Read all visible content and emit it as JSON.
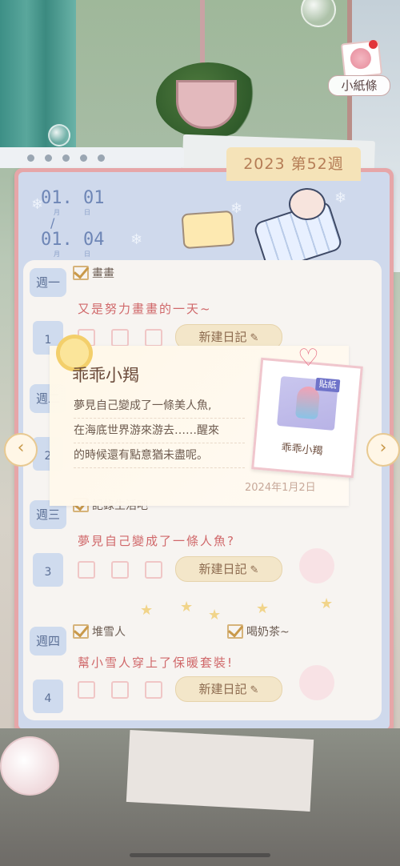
{
  "app": {
    "note_button_label": "小紙條"
  },
  "diary": {
    "week_tab": "2023 第52週",
    "date_start": "01. 01",
    "date_start_sub": [
      "月",
      "日"
    ],
    "date_end": "01. 04",
    "date_end_sub": [
      "月",
      "日"
    ],
    "date_separator": "/"
  },
  "days": [
    {
      "label": "週一",
      "num": "1",
      "task": "畫畫",
      "entry": "又是努力畫畫的一天~",
      "new_btn": "新建日記"
    },
    {
      "label": "週二",
      "num": "2",
      "task": "",
      "entry": "",
      "new_btn": ""
    },
    {
      "label": "週三",
      "num": "3",
      "task": "記錄生活吧",
      "entry": "夢見自己變成了一條人魚?",
      "new_btn": "新建日記"
    },
    {
      "label": "週四",
      "num": "4",
      "task": "堆雪人",
      "task2": "喝奶茶~",
      "entry": "幫小雪人穿上了保暖套裝!",
      "new_btn": "新建日記"
    }
  ],
  "popup": {
    "title": "乖乖小羯",
    "body_lines": [
      "夢見自己變成了一條美人魚,",
      "在海底世界游來游去……醒來",
      "的時候還有點意猶未盡呢。"
    ],
    "date": "2024年1月2日",
    "sticker_tag": "貼紙",
    "sticker_name": "乖乖小羯"
  },
  "icons": {
    "prev": "chevron-left-icon",
    "next": "chevron-right-icon",
    "pen": "edit-pen-icon",
    "heart": "heart-icon"
  },
  "colors": {
    "accent": "#c9994a",
    "entry_text": "#d0686a",
    "book_border": "#e6a6a8"
  }
}
